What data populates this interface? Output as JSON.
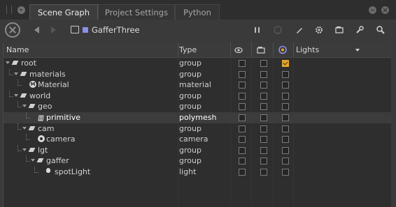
{
  "tabs": [
    "Scene Graph",
    "Project Settings",
    "Python"
  ],
  "breadcrumb": {
    "label": "GafferThree"
  },
  "colors": {
    "accent_checkbox": "#e3a531",
    "breadcrumb_square": "#8b8fe6",
    "selected_row": "#3c3c3c"
  },
  "toolbar_icons": [
    "stop-icon",
    "back-arrow-icon",
    "forward-arrow-icon",
    "pause-icon",
    "spinner-icon",
    "pen-icon",
    "gear-icon",
    "viewer-icon",
    "wrench-icon",
    "search-icon"
  ],
  "columns": {
    "name": "Name",
    "type": "Type",
    "lights": "Lights"
  },
  "rows": [
    {
      "name": "root",
      "type": "group",
      "depth": 0,
      "icon": "locator",
      "expanded": true,
      "c1": false,
      "c2": false,
      "c3": true
    },
    {
      "name": "materials",
      "type": "group",
      "depth": 1,
      "icon": "locator",
      "expanded": true,
      "c1": false,
      "c2": false,
      "c3": false
    },
    {
      "name": "Material",
      "type": "material",
      "depth": 2,
      "icon": "material",
      "expanded": false,
      "c1": false,
      "c2": false,
      "c3": false
    },
    {
      "name": "world",
      "type": "group",
      "depth": 1,
      "icon": "locator",
      "expanded": true,
      "c1": false,
      "c2": false,
      "c3": false
    },
    {
      "name": "geo",
      "type": "group",
      "depth": 2,
      "icon": "locator",
      "expanded": true,
      "c1": false,
      "c2": false,
      "c3": false
    },
    {
      "name": "primitive",
      "type": "polymesh",
      "depth": 3,
      "icon": "mesh",
      "expanded": false,
      "selected": true,
      "c1": false,
      "c2": false,
      "c3": false
    },
    {
      "name": "cam",
      "type": "group",
      "depth": 2,
      "icon": "locator",
      "expanded": true,
      "c1": false,
      "c2": false,
      "c3": false
    },
    {
      "name": "camera",
      "type": "camera",
      "depth": 3,
      "icon": "camera",
      "expanded": false,
      "c1": false,
      "c2": false,
      "c3": false
    },
    {
      "name": "lgt",
      "type": "group",
      "depth": 2,
      "icon": "locator",
      "expanded": true,
      "c1": false,
      "c2": false,
      "c3": false
    },
    {
      "name": "gaffer",
      "type": "group",
      "depth": 3,
      "icon": "locator",
      "expanded": true,
      "c1": false,
      "c2": false,
      "c3": false
    },
    {
      "name": "spotLight",
      "type": "light",
      "depth": 4,
      "icon": "light",
      "expanded": false,
      "c1": false,
      "c2": false,
      "c3": false
    }
  ]
}
